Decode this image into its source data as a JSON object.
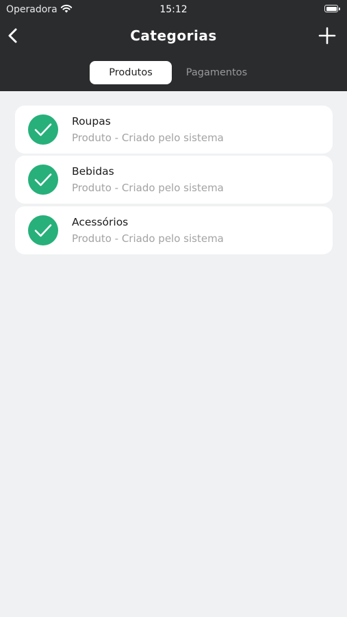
{
  "status": {
    "carrier": "Operadora",
    "time": "15:12"
  },
  "nav": {
    "title": "Categorias"
  },
  "tabs": [
    {
      "label": "Produtos",
      "active": true
    },
    {
      "label": "Pagamentos",
      "active": false
    }
  ],
  "categories": [
    {
      "name": "Roupas",
      "subtitle": "Produto - Criado pelo sistema"
    },
    {
      "name": "Bebidas",
      "subtitle": "Produto - Criado pelo sistema"
    },
    {
      "name": "Acessórios",
      "subtitle": "Produto - Criado pelo sistema"
    }
  ],
  "colors": {
    "header": "#2b2c2e",
    "background": "#f0f1f3",
    "check": "#27b07a"
  },
  "icons": {
    "back": "chevron-left-icon",
    "add": "plus-icon",
    "check": "checkmark-icon",
    "wifi": "wifi-icon",
    "battery": "battery-icon"
  }
}
